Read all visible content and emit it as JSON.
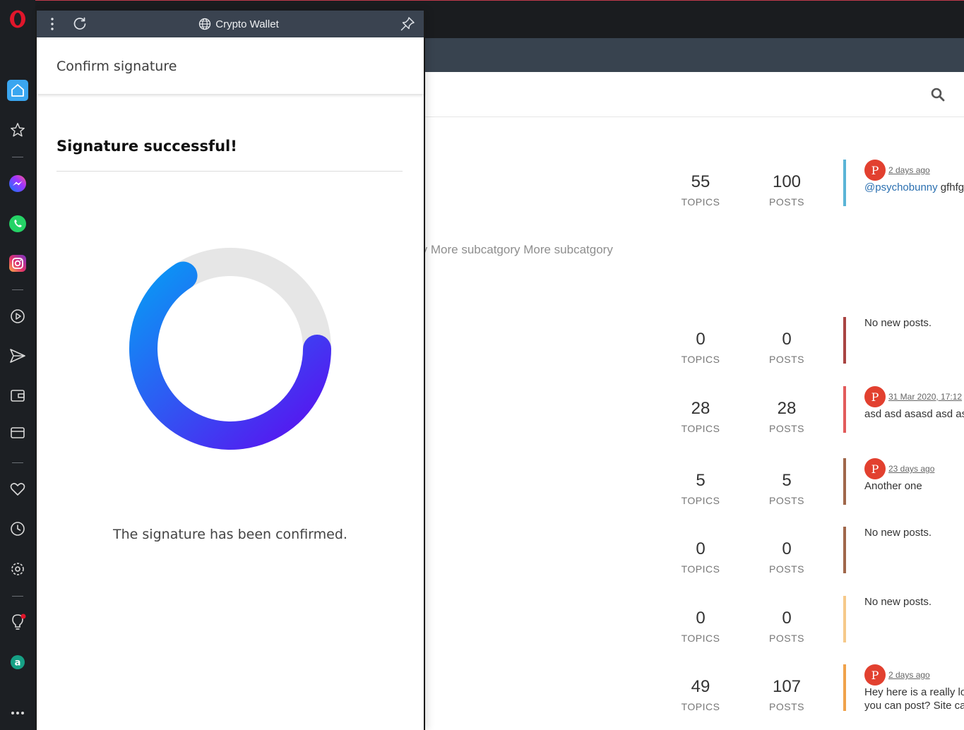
{
  "wallet": {
    "window_title": "Crypto Wallet",
    "header_title": "Confirm signature",
    "success_heading": "Signature successful!",
    "confirmed_text": "The signature has been confirmed.",
    "ring_colors": {
      "start": "#0a97f5",
      "end": "#5a10f0",
      "track": "#e6e6e6"
    }
  },
  "forum": {
    "subcategories_text": "ry More subcatgory More subcatgory",
    "topics_label": "TOPICS",
    "posts_label": "POSTS",
    "rows": [
      {
        "topics": "55",
        "posts": "100",
        "bar_color": "#5ab4d6",
        "avatar": "P",
        "date": "2 days ago",
        "user": "@psychobunny",
        "msg": " gfhfg",
        "msg2": ""
      },
      {
        "topics": "0",
        "posts": "0",
        "bar_color": "#a94442",
        "no_new": "No new posts."
      },
      {
        "topics": "28",
        "posts": "28",
        "bar_color": "#e25b5b",
        "avatar": "P",
        "date": "31 Mar 2020, 17:12",
        "user": "",
        "msg": "asd asd asasd asd asa",
        "msg2": ""
      },
      {
        "topics": "5",
        "posts": "5",
        "bar_color": "#a0674a",
        "avatar": "P",
        "date": "23 days ago",
        "user": "",
        "msg": "Another one",
        "msg2": ""
      },
      {
        "topics": "0",
        "posts": "0",
        "bar_color": "#a0674a",
        "no_new": "No new posts."
      },
      {
        "topics": "0",
        "posts": "0",
        "bar_color": "#f6c98a",
        "no_new": "No new posts."
      },
      {
        "topics": "49",
        "posts": "107",
        "bar_color": "#f0a24a",
        "avatar": "P",
        "date": "2 days ago",
        "user": "",
        "msg": "Hey here is a really lo",
        "msg2": "you can post? Site car"
      }
    ]
  },
  "sidebar": {
    "items": [
      "opera-logo",
      "home-icon",
      "star-icon",
      "messenger-icon",
      "whatsapp-icon",
      "instagram-icon",
      "player-icon",
      "send-icon",
      "wallet-icon",
      "card-icon",
      "heart-icon",
      "history-icon",
      "settings-icon",
      "lightbulb-icon",
      "aria-icon",
      "more-icon"
    ],
    "accent": "#3aa6f0"
  }
}
